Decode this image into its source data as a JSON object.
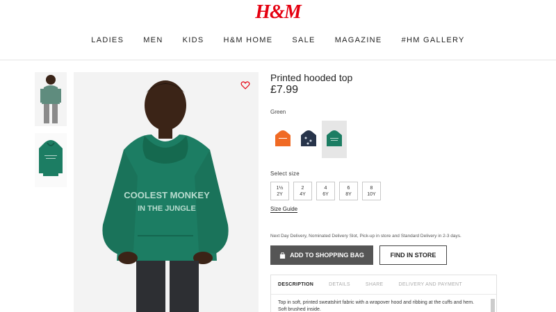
{
  "brand": {
    "logo": "H&M",
    "accent": "#e50010"
  },
  "nav": [
    "LADIES",
    "MEN",
    "KIDS",
    "H&M HOME",
    "SALE",
    "MAGAZINE",
    "#HM GALLERY"
  ],
  "product": {
    "title": "Printed hooded top",
    "price": "£7.99",
    "color_label": "Green",
    "hoodie_print": [
      "COOLEST MONKEY",
      "IN THE JUNGLE"
    ],
    "swatches": [
      {
        "name": "orange-hoodie",
        "color": "#f06a24"
      },
      {
        "name": "navy-hoodie",
        "color": "#27344a"
      },
      {
        "name": "green-hoodie",
        "color": "#1c7d63",
        "selected": true
      }
    ],
    "select_size_label": "Select size",
    "sizes": [
      {
        "top": "1½",
        "bottom": "2Y"
      },
      {
        "top": "2",
        "bottom": "4Y"
      },
      {
        "top": "4",
        "bottom": "6Y"
      },
      {
        "top": "6",
        "bottom": "8Y"
      },
      {
        "top": "8",
        "bottom": "10Y"
      }
    ],
    "size_guide": "Size Guide",
    "delivery_text": "Next Day Delivery, Nominated Delivery Slot, Pick-up in store and Standard Delivery in 2-3 days.",
    "add_to_bag": "ADD TO SHOPPING BAG",
    "find_in_store": "FIND IN STORE",
    "tabs": [
      "DESCRIPTION",
      "DETAILS",
      "SHARE",
      "DELIVERY AND PAYMENT"
    ],
    "description": "Top in soft, printed sweatshirt fabric with a wrapover hood and ribbing at the cuffs and hem. Soft brushed inside."
  }
}
